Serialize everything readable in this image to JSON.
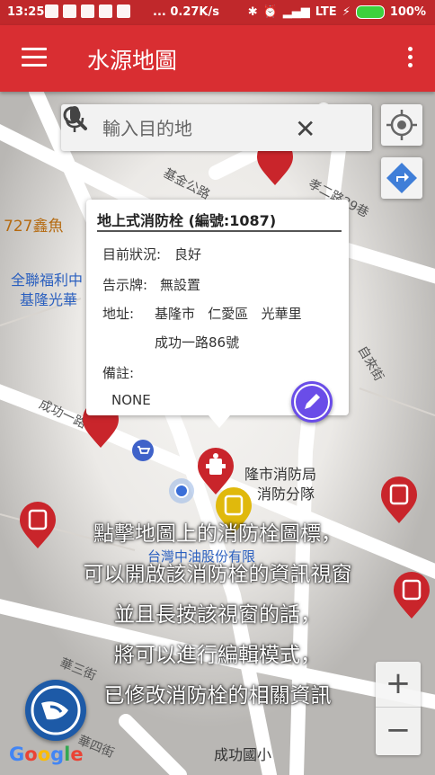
{
  "status_bar": {
    "time": "13:25",
    "network_speed": "... 0.27K/s",
    "network_type": "LTE",
    "battery": "100%"
  },
  "app_bar": {
    "title": "水源地圖"
  },
  "search": {
    "placeholder": "輸入目的地"
  },
  "map": {
    "labels": {
      "street_top": "基金公路",
      "street_right": "孝二路29巷",
      "poi_727": "727鑫魚",
      "poi_fulllian_1": "全聯福利中",
      "poi_fulllian_2": "基隆光華",
      "street_left": "成功一路",
      "street_right2": "自來街",
      "fire_bureau_1": "隆市消防局",
      "fire_bureau_2": "消防分隊",
      "cpc": "台灣中油股份有限",
      "street_bottom": "華三街",
      "street_bottom2": "華四街",
      "school": "成功國小",
      "google": "Google"
    }
  },
  "info_window": {
    "title": "地上式消防栓 (編號:1087)",
    "status_label": "目前狀況:",
    "status_value": "良好",
    "sign_label": "告示牌:",
    "sign_value": "無設置",
    "address_label": "地址:",
    "address_line1": "基隆市   仁愛區   光華里",
    "address_line2": "成功一路86號",
    "note_label": "備註:",
    "note_value": "NONE"
  },
  "caption": {
    "line1": "點擊地圖上的消防栓圖標，",
    "line2": "可以開啟該消防栓的資訊視窗",
    "line3": "並且長按該視窗的話，",
    "line4": "將可以進行編輯模式，",
    "line5": "已修改消防栓的相關資訊"
  },
  "zoom": {
    "in": "+",
    "out": "−"
  },
  "colors": {
    "app_bar": "#d92e32",
    "status_bar": "#c0282b",
    "edit_fab": "#6a4de8",
    "fab": "#1d5aa7"
  }
}
